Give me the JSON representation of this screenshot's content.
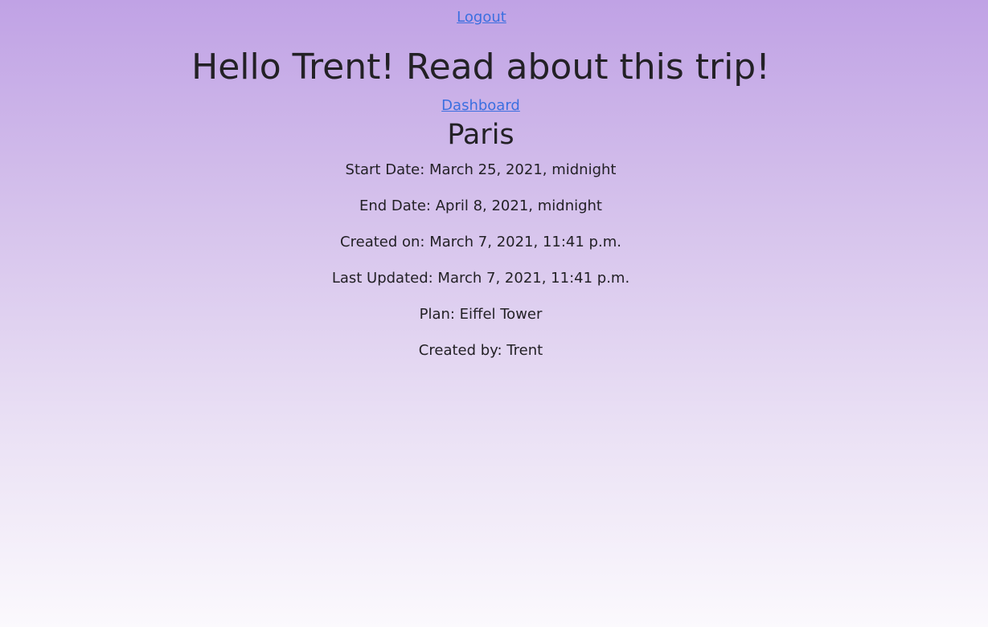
{
  "nav": {
    "logout_label": "Logout",
    "dashboard_label": "Dashboard"
  },
  "page": {
    "heading": "Hello Trent! Read about this trip!"
  },
  "trip": {
    "title": "Paris",
    "start_date": "Start Date: March 25, 2021, midnight",
    "end_date": "End Date: April 8, 2021, midnight",
    "created_on": "Created on: March 7, 2021, 11:41 p.m.",
    "last_updated": "Last Updated: March 7, 2021, 11:41 p.m.",
    "plan": "Plan: Eiffel Tower",
    "created_by": "Created by: Trent"
  },
  "colors": {
    "link": "#3b6fe0",
    "text": "#232126",
    "background_top": "#c0a2e5",
    "background_bottom": "#fbf9fd"
  }
}
